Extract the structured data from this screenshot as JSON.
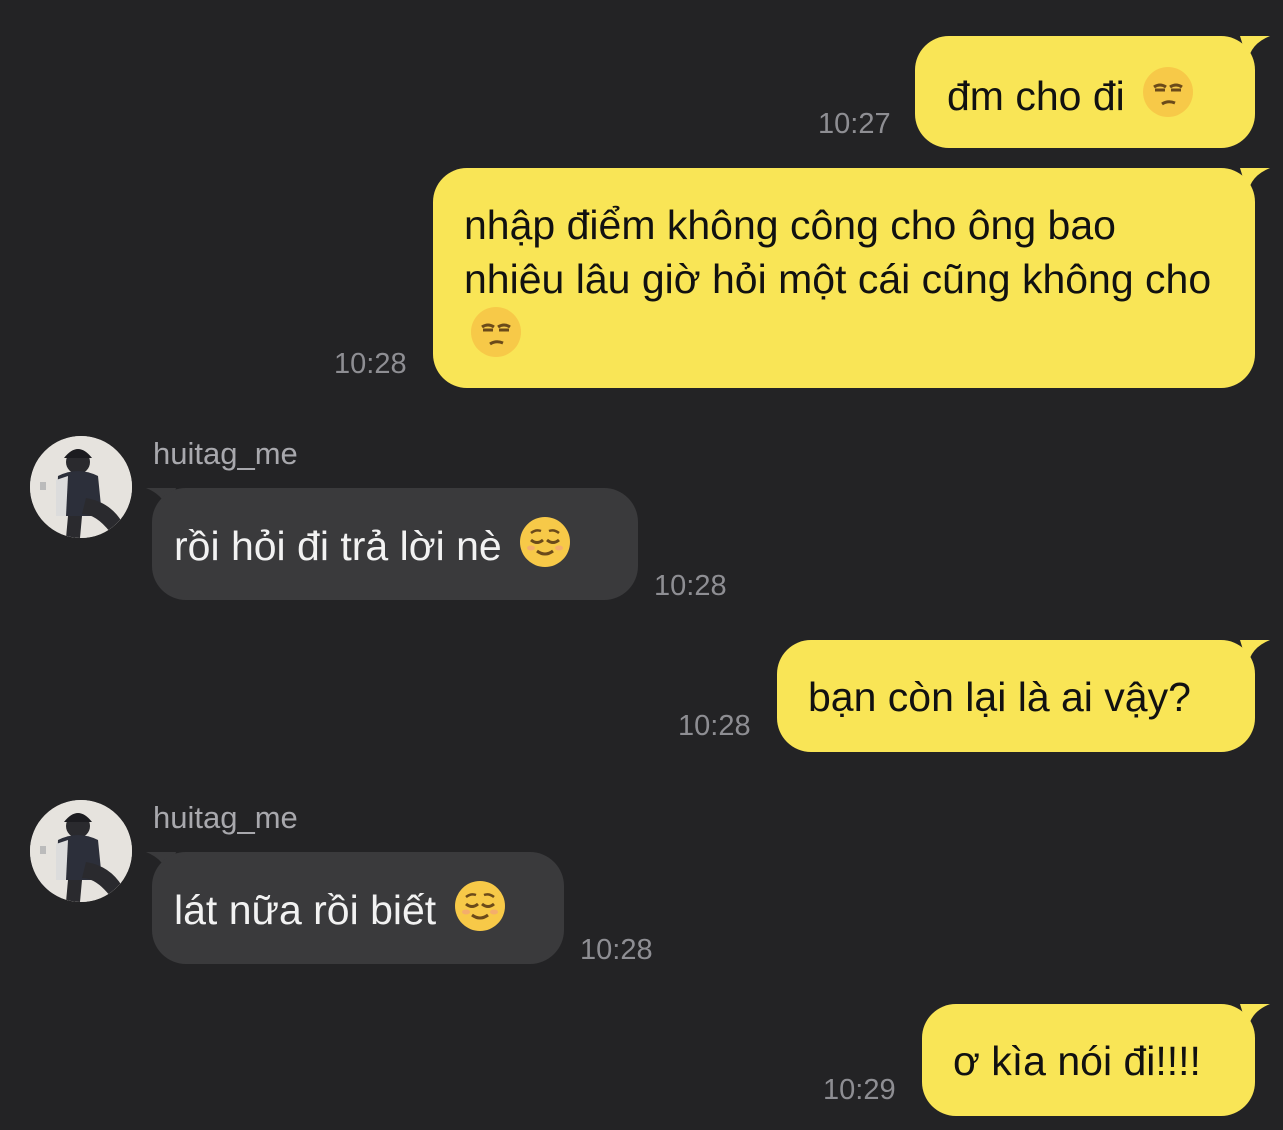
{
  "messages": [
    {
      "dir": "out",
      "text": "đm cho đi",
      "emoji": "unamused-face",
      "time": "10:27"
    },
    {
      "dir": "out",
      "text": "nhập điểm không công cho ông bao nhiêu lâu giờ hỏi một cái cũng không cho",
      "emoji": "unamused-face",
      "time": "10:28"
    },
    {
      "dir": "in",
      "sender": "huitag_me",
      "text": "rồi hỏi đi trả lời nè",
      "emoji": "relieved-face",
      "time": "10:28"
    },
    {
      "dir": "out",
      "text": "bạn còn lại là ai vậy?",
      "time": "10:28"
    },
    {
      "dir": "in",
      "sender": "huitag_me",
      "text": "lát nữa rồi biết",
      "emoji": "relieved-face",
      "time": "10:28"
    },
    {
      "dir": "out",
      "text": "ơ kìa nói đi!!!!",
      "time": "10:29"
    }
  ],
  "colors": {
    "background": "#232325",
    "outgoing_bubble": "#f9e556",
    "incoming_bubble": "#3a3a3c",
    "timestamp": "#8e8e93"
  }
}
